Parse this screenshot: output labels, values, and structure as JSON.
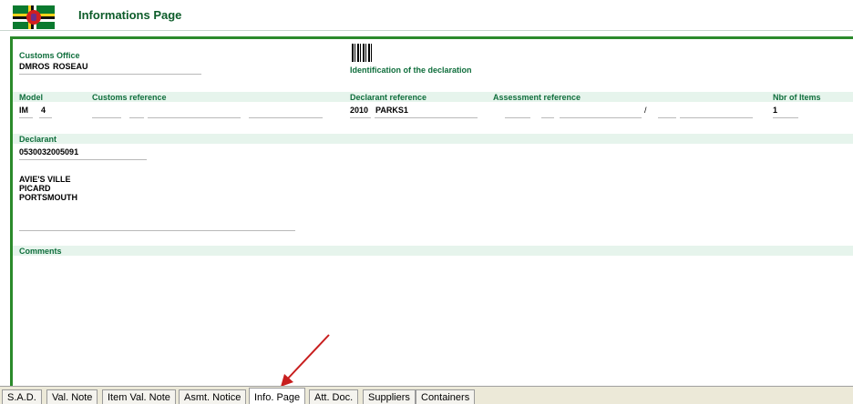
{
  "header": {
    "title": "Informations Page"
  },
  "customs_office": {
    "label": "Customs Office",
    "code": "DMROS",
    "name": "ROSEAU"
  },
  "identification": {
    "label": "Identification of the declaration"
  },
  "model": {
    "label": "Model",
    "type": "IM",
    "number": "4"
  },
  "customs_reference": {
    "label": "Customs reference"
  },
  "declarant_reference": {
    "label": "Declarant reference",
    "year": "2010",
    "ref": "PARKS1"
  },
  "assessment_reference": {
    "label": "Assessment reference",
    "separator": "/"
  },
  "items": {
    "label": "Nbr of Items",
    "value": "1"
  },
  "declarant": {
    "label": "Declarant",
    "code": "0530032005091",
    "address_line_1": "AVIE'S VILLE",
    "address_line_2": "PICARD",
    "address_line_3": "PORTSMOUTH"
  },
  "comments": {
    "label": "Comments"
  },
  "tabs": [
    {
      "label": "S.A.D."
    },
    {
      "label": "Val. Note"
    },
    {
      "label": "Item Val. Note"
    },
    {
      "label": "Asmt. Notice"
    },
    {
      "label": "Info. Page"
    },
    {
      "label": "Att. Doc."
    },
    {
      "label": "Suppliers"
    },
    {
      "label": "Containers"
    }
  ],
  "active_tab": "Info. Page",
  "colors": {
    "label_green": "#0f6e3c",
    "frame_green": "#2b8a2b",
    "band_green": "#e6f4ec",
    "annotation_arrow": "#c81e1e"
  }
}
